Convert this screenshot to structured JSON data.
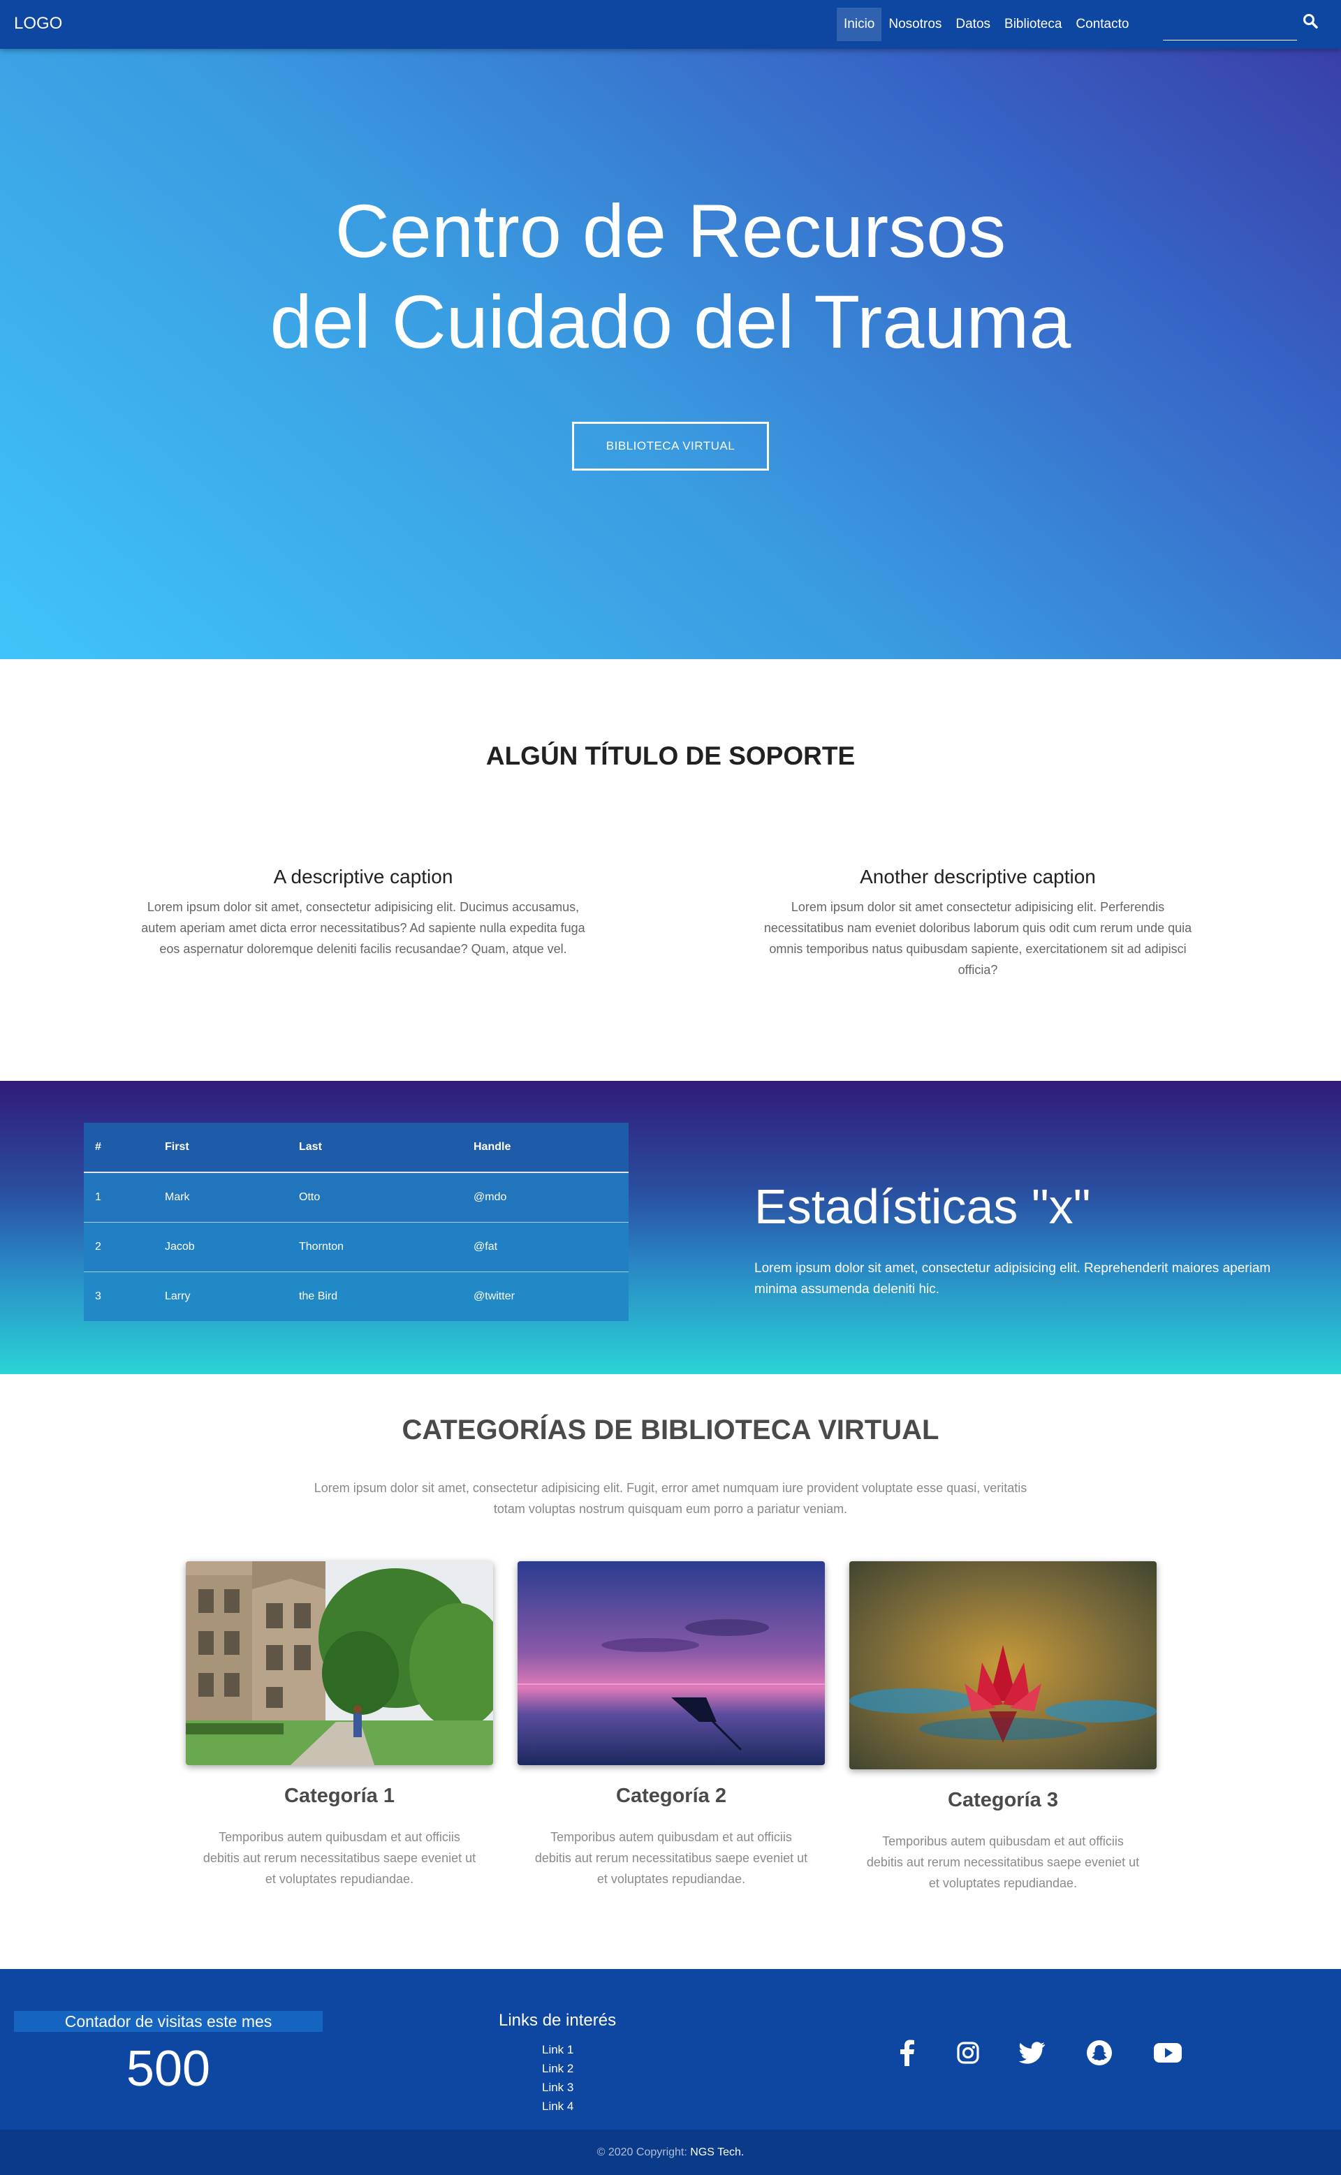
{
  "navbar": {
    "logo": "LOGO",
    "links": [
      "Inicio",
      "Nosotros",
      "Datos",
      "Biblioteca",
      "Contacto"
    ],
    "active_index": 0,
    "search_value": "",
    "search_icon": "search-icon",
    "background": "#0d47a1"
  },
  "hero": {
    "title_line1": "Centro de Recursos",
    "title_line2": "del Cuidado del Trauma",
    "button": "BIBLIOTECA VIRTUAL"
  },
  "support": {
    "title": "ALGÚN TÍTULO DE SOPORTE",
    "captions": [
      {
        "title": "A descriptive caption",
        "text": "Lorem ipsum dolor sit amet, consectetur adipisicing elit. Ducimus accusamus, autem aperiam amet dicta error necessitatibus? Ad sapiente nulla expedita fuga eos aspernatur doloremque deleniti facilis recusandae? Quam, atque vel."
      },
      {
        "title": "Another descriptive caption",
        "text": "Lorem ipsum dolor sit amet consectetur adipisicing elit. Perferendis necessitatibus nam eveniet doloribus laborum quis odit cum rerum unde quia omnis temporibus natus quibusdam sapiente, exercitationem sit ad adipisci officia?"
      }
    ]
  },
  "stats": {
    "table": {
      "headers": [
        "#",
        "First",
        "Last",
        "Handle"
      ],
      "rows": [
        [
          "1",
          "Mark",
          "Otto",
          "@mdo"
        ],
        [
          "2",
          "Jacob",
          "Thornton",
          "@fat"
        ],
        [
          "3",
          "Larry",
          "the Bird",
          "@twitter"
        ]
      ]
    },
    "title": "Estadísticas \"x\"",
    "text": "Lorem ipsum dolor sit amet, consectetur adipisicing elit. Reprehenderit maiores aperiam minima assumenda deleniti hic."
  },
  "categories": {
    "title": "CATEGORÍAS DE BIBLIOTECA VIRTUAL",
    "intro": "Lorem ipsum dolor sit amet, consectetur adipisicing elit. Fugit, error amet numquam iure provident voluptate esse quasi, veritatis totam voluptas nostrum quisquam eum porro a pariatur veniam.",
    "items": [
      {
        "name": "Categoría 1",
        "text": "Temporibus autem quibusdam et aut officiis debitis aut rerum necessitatibus saepe eveniet ut et voluptates repudiandae."
      },
      {
        "name": "Categoría 2",
        "text": "Temporibus autem quibusdam et aut officiis debitis aut rerum necessitatibus saepe eveniet ut et voluptates repudiandae."
      },
      {
        "name": "Categoría 3",
        "text": "Temporibus autem quibusdam et aut officiis debitis aut rerum necessitatibus saepe eveniet ut et voluptates repudiandae."
      }
    ]
  },
  "footer": {
    "visits_label": "Contador de visitas este mes",
    "visits_count": "500",
    "links_title": "Links de interés",
    "links": [
      "Link 1",
      "Link 2",
      "Link 3",
      "Link 4"
    ],
    "social_icons": [
      "facebook-icon",
      "instagram-icon",
      "twitter-icon",
      "snapchat-icon",
      "youtube-icon"
    ],
    "copyright_prefix": "© 2020 Copyright:",
    "copyright_brand": "NGS Tech."
  }
}
